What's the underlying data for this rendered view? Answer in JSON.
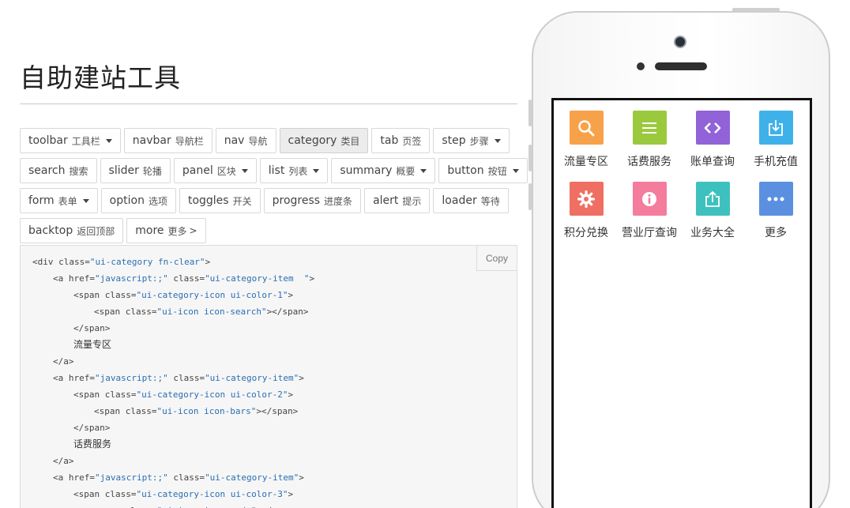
{
  "header": {
    "title": "自助建站工具"
  },
  "nav_rows": [
    [
      {
        "en": "toolbar",
        "zh": "工具栏",
        "dropdown": true
      },
      {
        "en": "navbar",
        "zh": "导航栏",
        "dropdown": false
      },
      {
        "en": "nav",
        "zh": "导航",
        "dropdown": false
      },
      {
        "en": "category",
        "zh": "类目",
        "dropdown": false,
        "active": true
      },
      {
        "en": "tab",
        "zh": "页签",
        "dropdown": false
      },
      {
        "en": "step",
        "zh": "步骤",
        "dropdown": true
      }
    ],
    [
      {
        "en": "search",
        "zh": "搜索",
        "dropdown": false
      },
      {
        "en": "slider",
        "zh": "轮播",
        "dropdown": false
      },
      {
        "en": "panel",
        "zh": "区块",
        "dropdown": true
      },
      {
        "en": "list",
        "zh": "列表",
        "dropdown": true
      },
      {
        "en": "summary",
        "zh": "概要",
        "dropdown": true
      },
      {
        "en": "button",
        "zh": "按钮",
        "dropdown": true
      }
    ],
    [
      {
        "en": "form",
        "zh": "表单",
        "dropdown": true
      },
      {
        "en": "option",
        "zh": "选项",
        "dropdown": false
      },
      {
        "en": "toggles",
        "zh": "开关",
        "dropdown": false
      },
      {
        "en": "progress",
        "zh": "进度条",
        "dropdown": false
      },
      {
        "en": "alert",
        "zh": "提示",
        "dropdown": false
      },
      {
        "en": "loader",
        "zh": "等待",
        "dropdown": false
      }
    ],
    [
      {
        "en": "backtop",
        "zh": "返回顶部",
        "dropdown": false
      },
      {
        "en": "more",
        "zh": "更多",
        "dropdown": false,
        "suffix": ">"
      }
    ]
  ],
  "code": {
    "copy_label": "Copy",
    "lines": [
      {
        "indent": 0,
        "parts": [
          [
            "t",
            "<div class="
          ],
          [
            "s",
            "\"ui-category fn-clear\""
          ],
          [
            "t",
            ">"
          ]
        ]
      },
      {
        "indent": 1,
        "parts": [
          [
            "t",
            "<a href="
          ],
          [
            "s",
            "\"javascript:;\""
          ],
          [
            "t",
            " class="
          ],
          [
            "s",
            "\"ui-category-item  \""
          ],
          [
            "t",
            ">"
          ]
        ]
      },
      {
        "indent": 2,
        "parts": [
          [
            "t",
            "<span class="
          ],
          [
            "s",
            "\"ui-category-icon ui-color-1\""
          ],
          [
            "t",
            ">"
          ]
        ]
      },
      {
        "indent": 3,
        "parts": [
          [
            "t",
            "<span class="
          ],
          [
            "s",
            "\"ui-icon icon-search\""
          ],
          [
            "t",
            "></span>"
          ]
        ]
      },
      {
        "indent": 2,
        "parts": [
          [
            "t",
            "</span>"
          ]
        ]
      },
      {
        "indent": 2,
        "parts": [
          [
            "x",
            "流量专区"
          ]
        ]
      },
      {
        "indent": 1,
        "parts": [
          [
            "t",
            "</a>"
          ]
        ]
      },
      {
        "indent": 1,
        "parts": [
          [
            "t",
            "<a href="
          ],
          [
            "s",
            "\"javascript:;\""
          ],
          [
            "t",
            " class="
          ],
          [
            "s",
            "\"ui-category-item\""
          ],
          [
            "t",
            ">"
          ]
        ]
      },
      {
        "indent": 2,
        "parts": [
          [
            "t",
            "<span class="
          ],
          [
            "s",
            "\"ui-category-icon ui-color-2\""
          ],
          [
            "t",
            ">"
          ]
        ]
      },
      {
        "indent": 3,
        "parts": [
          [
            "t",
            "<span class="
          ],
          [
            "s",
            "\"ui-icon icon-bars\""
          ],
          [
            "t",
            "></span>"
          ]
        ]
      },
      {
        "indent": 2,
        "parts": [
          [
            "t",
            "</span>"
          ]
        ]
      },
      {
        "indent": 2,
        "parts": [
          [
            "x",
            "话费服务"
          ]
        ]
      },
      {
        "indent": 1,
        "parts": [
          [
            "t",
            "</a>"
          ]
        ]
      },
      {
        "indent": 1,
        "parts": [
          [
            "t",
            "<a href="
          ],
          [
            "s",
            "\"javascript:;\""
          ],
          [
            "t",
            " class="
          ],
          [
            "s",
            "\"ui-category-item\""
          ],
          [
            "t",
            ">"
          ]
        ]
      },
      {
        "indent": 2,
        "parts": [
          [
            "t",
            "<span class="
          ],
          [
            "s",
            "\"ui-category-icon ui-color-3\""
          ],
          [
            "t",
            ">"
          ]
        ]
      },
      {
        "indent": 3,
        "parts": [
          [
            "t",
            "<span class="
          ],
          [
            "s",
            "\"ui-icon icon-code\""
          ],
          [
            "t",
            "></span>"
          ]
        ]
      }
    ]
  },
  "phone": {
    "categories": [
      {
        "label": "流量专区",
        "icon": "search-icon",
        "color": "#f7a24a"
      },
      {
        "label": "话费服务",
        "icon": "bars-icon",
        "color": "#9bc93e"
      },
      {
        "label": "账单查询",
        "icon": "code-icon",
        "color": "#9162d8"
      },
      {
        "label": "手机充值",
        "icon": "download-icon",
        "color": "#3fb1e9"
      },
      {
        "label": "积分兑换",
        "icon": "gear-icon",
        "color": "#ef6f63"
      },
      {
        "label": "营业厅查询",
        "icon": "info-icon",
        "color": "#f47c9c"
      },
      {
        "label": "业务大全",
        "icon": "share-icon",
        "color": "#3ec1be"
      },
      {
        "label": "更多",
        "icon": "more-icon",
        "color": "#5b8fe0"
      }
    ]
  }
}
